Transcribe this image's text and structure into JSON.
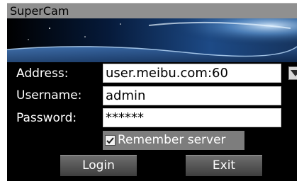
{
  "window": {
    "title": "SuperCam"
  },
  "form": {
    "address_label": "Address:",
    "address_value": "user.meibu.com:60",
    "username_label": "Username:",
    "username_value": "admin",
    "password_label": "Password:",
    "password_value": "******",
    "remember_label": "Remember server",
    "remember_checked": true
  },
  "buttons": {
    "login_label": "Login",
    "exit_label": "Exit"
  },
  "icons": {
    "dropdown": "triangle-down-icon",
    "checkbox": "checkmark-icon"
  },
  "colors": {
    "titlebar": "#909090",
    "background": "#000000",
    "field": "#ffffff",
    "remember_bar": "#7d7d7d"
  }
}
